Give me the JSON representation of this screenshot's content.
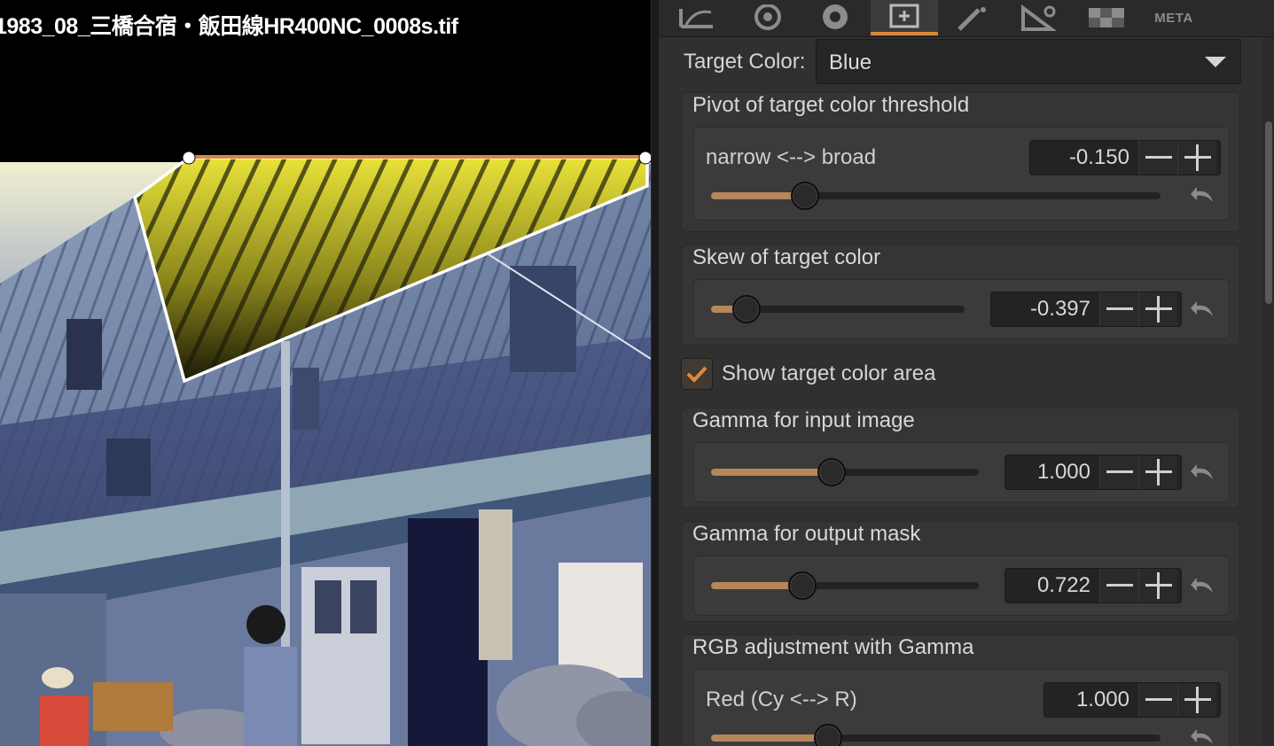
{
  "viewer": {
    "filename": "1983_08_三橋合宿・飯田線HR400NC_0008s.tif"
  },
  "tabs": [
    {
      "icon": "tone-curve-icon",
      "active": false
    },
    {
      "icon": "color-balance-icon",
      "active": false
    },
    {
      "icon": "color-wheel-icon",
      "active": false
    },
    {
      "icon": "target-color-icon",
      "active": true
    },
    {
      "icon": "magic-wand-icon",
      "active": false
    },
    {
      "icon": "geometry-ruler-icon",
      "active": false
    },
    {
      "icon": "checkerboard-icon",
      "active": false
    },
    {
      "icon": "meta-icon",
      "active": false,
      "label": "META"
    }
  ],
  "colors": {
    "accent": "#d9873a",
    "slider_fill": "#b5875a",
    "highlight_mask": "#e8e23a"
  },
  "target": {
    "label": "Target Color:",
    "value": "Blue"
  },
  "pivot": {
    "title": "Pivot of target color threshold",
    "label": "narrow <--> broad",
    "value": "-0.150",
    "position": 0.21
  },
  "skew": {
    "title": "Skew of target color",
    "value": "-0.397",
    "position": 0.14
  },
  "show_area": {
    "label": "Show target color area",
    "checked": true
  },
  "gamma_input": {
    "title": "Gamma for input image",
    "value": "1.000",
    "position": 0.45
  },
  "gamma_output": {
    "title": "Gamma for output mask",
    "value": "0.722",
    "position": 0.34
  },
  "rgb": {
    "title": "RGB adjustment with Gamma",
    "red_label": "Red (Cy <--> R)",
    "red_value": "1.000",
    "red_position": 0.26
  }
}
